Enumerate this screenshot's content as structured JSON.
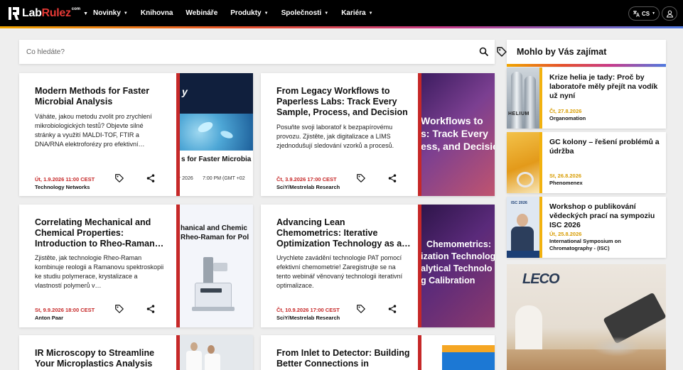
{
  "header": {
    "logo_text_a": "Lab",
    "logo_text_b": "Rulez",
    "logo_sup": "com",
    "nav": [
      {
        "label": "Novinky",
        "dropdown": true
      },
      {
        "label": "Knihovna",
        "dropdown": false
      },
      {
        "label": "Webináře",
        "dropdown": false
      },
      {
        "label": "Produkty",
        "dropdown": true
      },
      {
        "label": "Společnosti",
        "dropdown": true
      },
      {
        "label": "Kariéra",
        "dropdown": true
      }
    ],
    "lang": "CS"
  },
  "search": {
    "placeholder": "Co hledáte?"
  },
  "cards": [
    {
      "title": "Modern Methods for Faster Microbial Analysis",
      "desc": "Váháte, jakou metodu zvolit pro zrychlení mikrobiologických testů? Objevte silné stránky a využití MALDI-TOF, FTIR a DNA/RNA elektroforézy pro efektivní…",
      "date": "Út, 1.9.2026 11:00 CEST",
      "org": "Technology Networks",
      "img_caption": "s for Faster Microbia",
      "img_top_text": "y",
      "img_footer_a": "er 2026",
      "img_footer_b": "7:00 PM (GMT +02"
    },
    {
      "title": "From Legacy Workflows to Paperless Labs: Track Every Sample, Process, and Decision",
      "desc": "Posuňte svoji laboratoř k bezpapírovému provozu. Zjistěte, jak digitalizace a LIMS zjednodušují sledování vzorků a procesů.",
      "date": "Čt, 3.9.2026 17:00 CEST",
      "org": "SciY/Mestrelab Research",
      "img_lines": [
        "Workflows to",
        "s: Track Every",
        "ess, and Decisio"
      ]
    },
    {
      "title": "Correlating Mechanical and Chemical Properties: Introduction to Rheo-Raman…",
      "desc": "Zjistěte, jak technologie Rheo-Raman kombinuje reologii a Ramanovu spektroskopii ke studiu polymerace, krystalizace a vlastností polymerů v…",
      "date": "St, 9.9.2026 18:00 CEST",
      "org": "Anton Paar",
      "img_lines": [
        "hanical and Chemic",
        "Rheo-Raman for Pol"
      ]
    },
    {
      "title": "Advancing Lean Chemometrics: Iterative Optimization Technology as a…",
      "desc": "Urychlete zavádění technologie PAT pomocí efektivní chemometrie! Zaregistrujte se na tento webinář věnovaný technologii iterativní optimalizace.",
      "date": "Čt, 10.9.2026 17:00 CEST",
      "org": "SciY/Mestrelab Research",
      "img_lines": [
        "Chemometrics:",
        "ization Technolog",
        "alytical Technolo",
        "g Calibration"
      ]
    },
    {
      "title": "IR Microscopy to Streamline Your Microplastics Analysis"
    },
    {
      "title": "From Inlet to Detector: Building Better Connections in"
    }
  ],
  "sidebar": {
    "heading": "Mohlo by Vás zajímat",
    "items": [
      {
        "title": "Krize helia je tady: Proč by laboratoře měly přejít na vodík už nyní",
        "date": "Čt, 27.8.2026",
        "org": "Organomation",
        "img_text": "HELIUM"
      },
      {
        "title": "GC kolony – řešení problémů a údržba",
        "date": "St, 26.8.2026",
        "org": "Phenomenex"
      },
      {
        "title": "Workshop o publikování vědeckých prací na sympoziu ISC 2026",
        "date": "Út, 25.8.2026",
        "org": "International Symposium on Chromatography - (ISC)",
        "img_text": "ISC 2026"
      }
    ],
    "ad_logo": "LECO"
  },
  "colors": {
    "accent_red": "#c62828",
    "accent_yellow": "#f2b20f",
    "nav_bg": "#000000"
  }
}
